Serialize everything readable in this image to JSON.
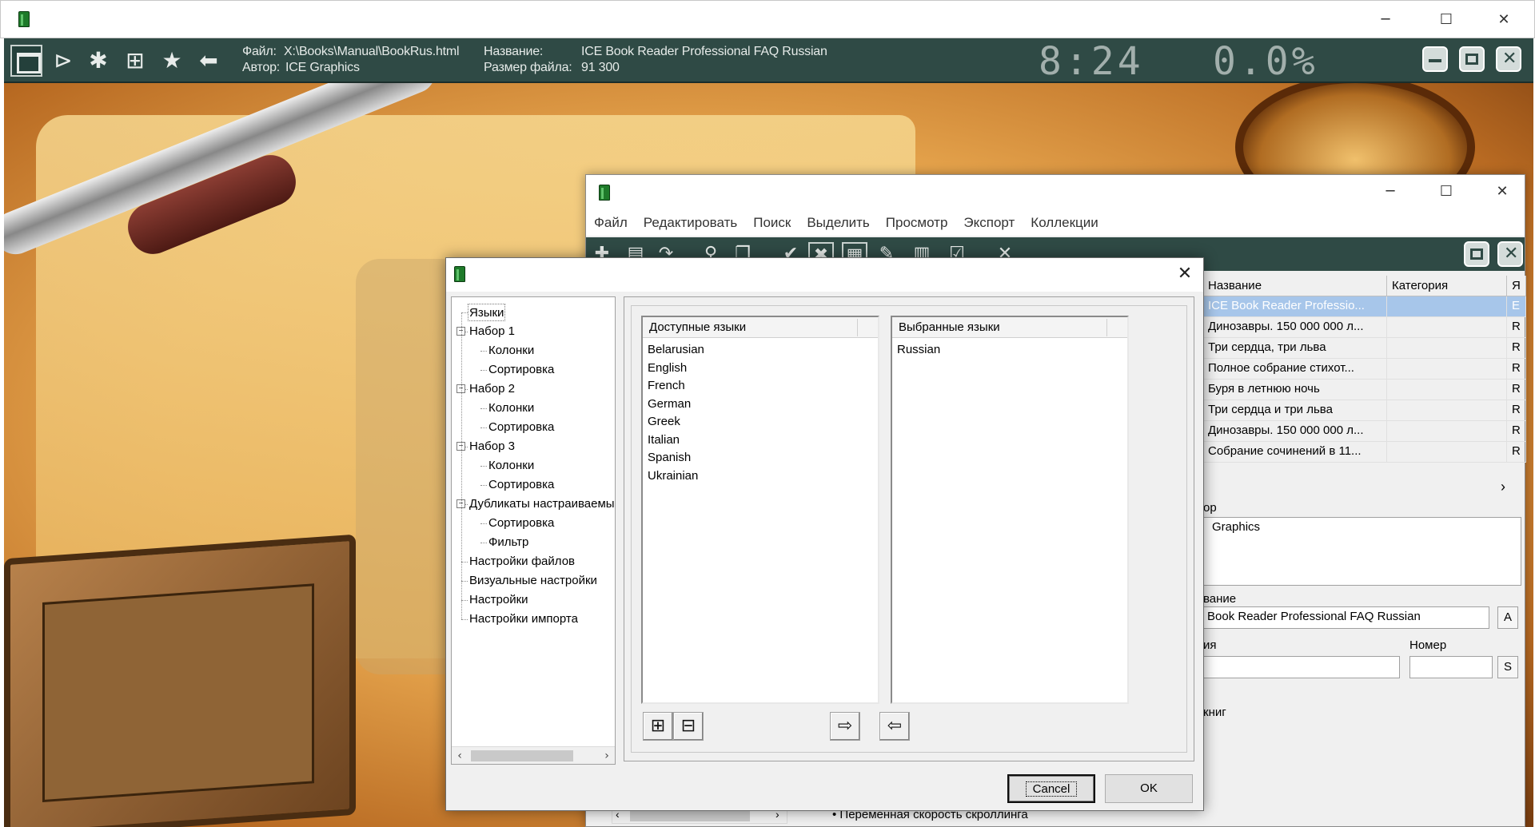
{
  "reader": {
    "file_label": "Файл:",
    "file_value": "X:\\Books\\Manual\\BookRus.html",
    "author_label": "Автор:",
    "author_value": "ICE Graphics",
    "title_label": "Название:",
    "title_value": "ICE Book Reader Professional FAQ Russian",
    "size_label": "Размер файла:",
    "size_value": "91 300",
    "clock": "8:24",
    "progress": "0.0%",
    "progress_fraction": 0.0
  },
  "collection": {
    "menu": [
      "Файл",
      "Редактировать",
      "Поиск",
      "Выделить",
      "Просмотр",
      "Экспорт",
      "Коллекции"
    ],
    "columns": [
      "Название",
      "Категория",
      "Я"
    ],
    "rows": [
      {
        "title": "ICE Book Reader Professio...",
        "category": "",
        "lang": "E"
      },
      {
        "title": "Динозавры. 150 000 000 л...",
        "category": "",
        "lang": "R"
      },
      {
        "title": "Три сердца, три льва",
        "category": "",
        "lang": "R"
      },
      {
        "title": "Полное собрание стихот...",
        "category": "",
        "lang": "R"
      },
      {
        "title": "Буря в летнюю ночь",
        "category": "",
        "lang": "R"
      },
      {
        "title": "Три сердца и три льва",
        "category": "",
        "lang": "R"
      },
      {
        "title": "Динозавры. 150 000 000 л...",
        "category": "",
        "lang": "R"
      },
      {
        "title": "Собрание сочинений в 11...",
        "category": "",
        "lang": "R"
      }
    ],
    "scroll_right": "›",
    "author_label": "ор",
    "author_value": "Graphics",
    "name_label": "вание",
    "name_value": "Book Reader Professional FAQ Russian",
    "name_btn": "A",
    "series_label": "ия",
    "number_label": "Номер",
    "number_btn": "S",
    "books_label": "книг",
    "bottom_bullet": "• Переменная скорость скроллинга"
  },
  "dialog": {
    "tree": [
      {
        "label": "Языки",
        "level": 0,
        "selected": true
      },
      {
        "label": "Набор 1",
        "level": 0,
        "toggle": "−"
      },
      {
        "label": "Колонки",
        "level": 1
      },
      {
        "label": "Сортировка",
        "level": 1
      },
      {
        "label": "Набор 2",
        "level": 0,
        "toggle": "−"
      },
      {
        "label": "Колонки",
        "level": 1
      },
      {
        "label": "Сортировка",
        "level": 1
      },
      {
        "label": "Набор 3",
        "level": 0,
        "toggle": "−"
      },
      {
        "label": "Колонки",
        "level": 1
      },
      {
        "label": "Сортировка",
        "level": 1
      },
      {
        "label": "Дубликаты настраиваемые",
        "level": 0,
        "toggle": "−"
      },
      {
        "label": "Сортировка",
        "level": 1
      },
      {
        "label": "Фильтр",
        "level": 1
      },
      {
        "label": "Настройки файлов",
        "level": 0
      },
      {
        "label": "Визуальные настройки",
        "level": 0
      },
      {
        "label": "Настройки",
        "level": 0
      },
      {
        "label": "Настройки импорта",
        "level": 0
      }
    ],
    "available_header": "Доступные языки",
    "available": [
      "Belarusian",
      "English",
      "French",
      "German",
      "Greek",
      "Italian",
      "Spanish",
      "Ukrainian"
    ],
    "selected_header": "Выбранные языки",
    "selected": [
      "Russian"
    ],
    "cancel_label": "Cancel",
    "ok_label": "OK"
  }
}
